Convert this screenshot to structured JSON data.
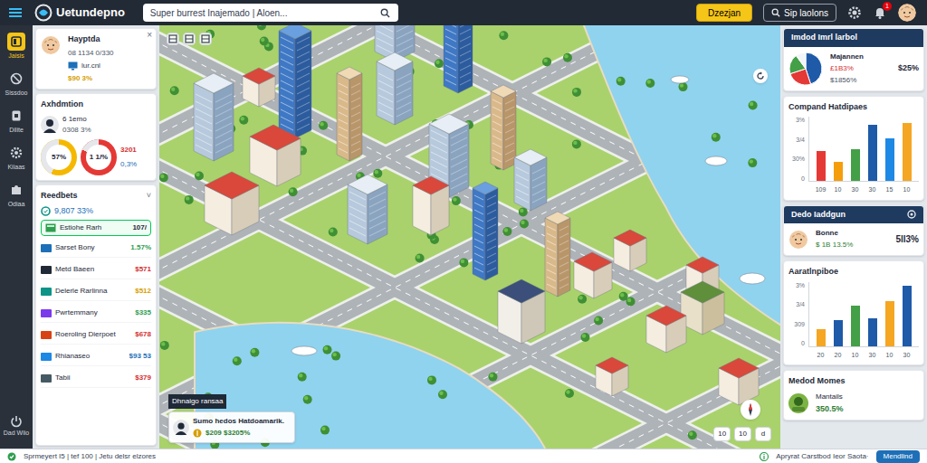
{
  "topbar": {
    "logo": "Uetundepno",
    "search": {
      "placeholder": "Super burrest Inajemado | Aloen..."
    },
    "buttons": [
      {
        "label": "Dzezjan",
        "kind": "primary"
      },
      {
        "label": "Sip laolons",
        "kind": "outline"
      }
    ],
    "notification_badge": "1"
  },
  "sidebar": {
    "items": [
      {
        "label": "Jaisis",
        "selected": true
      },
      {
        "label": "Sissdoo",
        "selected": false
      },
      {
        "label": "Dilite",
        "selected": false
      },
      {
        "label": "Kiiaas",
        "selected": false
      },
      {
        "label": "Odiaa",
        "selected": false
      }
    ],
    "footer": "Dad Wiio"
  },
  "left_panel": {
    "profile": {
      "name": "Hayptda",
      "id": "08 1134 0/330",
      "sub": "lur.cnl",
      "value": "$90 3%",
      "close": "×"
    },
    "activity": {
      "title": "Axhdmtion",
      "name": "6 1emo",
      "stat": "0308 3%",
      "donuts": [
        {
          "label": "57%",
          "level": 0.57,
          "color": "#f5b800"
        },
        {
          "label": "1 1/%",
          "level": 0.82,
          "color": "#e53935"
        }
      ],
      "side": [
        "3201",
        "0,3%"
      ]
    },
    "rewards": {
      "title": "Reedbets",
      "toggle": "˅",
      "summary": "9,807 33%",
      "highlight": {
        "label": "Estiohe Rarh",
        "value": "107/"
      },
      "rows": [
        {
          "label": "Sarset Bony",
          "value": "1.57%",
          "color": "#2e9e4f"
        },
        {
          "label": "Metd Baeen",
          "value": "$571",
          "color": "#d32f2f"
        },
        {
          "label": "Delerle Rarlinna",
          "value": "$512",
          "color": "#d69e00"
        },
        {
          "label": "Pwrtemmany",
          "value": "$335",
          "color": "#2e9e4f"
        },
        {
          "label": "Roeroling Dierpoet",
          "value": "$678",
          "color": "#d32f2f"
        },
        {
          "label": "Rhianaseo",
          "value": "$93 53",
          "color": "#1d6fb8"
        },
        {
          "label": "Tabii",
          "value": "$379",
          "color": "#d32f2f"
        }
      ]
    }
  },
  "map": {
    "tooltip": "Dhnaigo ransaa",
    "card": {
      "title": "Sumo hedos Hatdoamarik.",
      "value": "$209 $3205%"
    },
    "controls": [
      "10",
      "10",
      "d"
    ]
  },
  "right_panel": {
    "summary": {
      "title": "Imdod Imrl larbol",
      "label": "Majannen",
      "lines": [
        "£1B3%",
        "$1856%"
      ],
      "value": "$25%",
      "pie": [
        {
          "value": 45,
          "color": "#1e5aa8"
        },
        {
          "value": 25,
          "color": "#e53935"
        },
        {
          "value": 20,
          "color": "#43a047"
        },
        {
          "value": 10,
          "color": "#f1f5f9"
        }
      ]
    },
    "chart1": {
      "title": "Compand Hatdipaes",
      "ticks": [
        "3%",
        "3/4",
        "30%",
        "0"
      ],
      "axis_max": 3,
      "bars": [
        {
          "label": "109",
          "value": 1.4,
          "color": "#e53935"
        },
        {
          "label": "10",
          "value": 0.9,
          "color": "#f59e0b"
        },
        {
          "label": "30",
          "value": 1.5,
          "color": "#43a047"
        },
        {
          "label": "30",
          "value": 2.6,
          "color": "#1e5aa8"
        },
        {
          "label": "15",
          "value": 2.0,
          "color": "#1e88e5"
        },
        {
          "label": "10",
          "value": 2.7,
          "color": "#f5a623"
        }
      ]
    },
    "detail": {
      "title": "Dedo Iaddgun",
      "name": "Bonne",
      "sub": "$ 1B 13.5%",
      "value": "5ll3%"
    },
    "chart2": {
      "title": "Aaratlnpiboe",
      "ticks": [
        "3%",
        "3/4",
        "309",
        "0"
      ],
      "axis_max": 3,
      "bars": [
        {
          "label": "20",
          "value": 0.8,
          "color": "#f5a623"
        },
        {
          "label": "20",
          "value": 1.2,
          "color": "#1e5aa8"
        },
        {
          "label": "10",
          "value": 1.9,
          "color": "#43a047"
        },
        {
          "label": "30",
          "value": 1.3,
          "color": "#1e5aa8"
        },
        {
          "label": "10",
          "value": 2.1,
          "color": "#f5a623"
        },
        {
          "label": "30",
          "value": 2.8,
          "color": "#1e5aa8"
        }
      ]
    },
    "footer_card": {
      "title": "Medod Momes",
      "name": "Mantails",
      "value": "350.5%"
    }
  },
  "status_bar": {
    "left": "Sprmeyert I5 | tef 100 | Jetu delsr elzores",
    "right": "Apryrat Carstbod Ieor Saota·",
    "button": "Mendlind"
  }
}
